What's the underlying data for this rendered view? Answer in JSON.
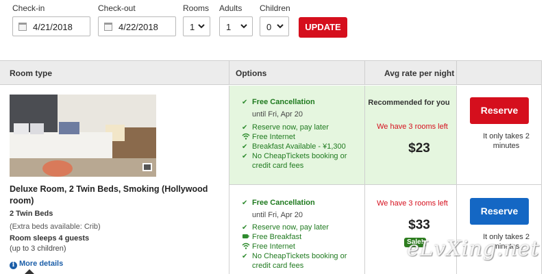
{
  "search": {
    "checkin_label": "Check-in",
    "checkin_value": "4/21/2018",
    "checkout_label": "Check-out",
    "checkout_value": "4/22/2018",
    "rooms_label": "Rooms",
    "rooms_value": "1",
    "adults_label": "Adults",
    "adults_value": "1",
    "children_label": "Children",
    "children_value": "0",
    "update_label": "UPDATE"
  },
  "table": {
    "col_room_type": "Room type",
    "col_options": "Options",
    "col_avg_rate": "Avg rate per night"
  },
  "room": {
    "photo_icon": "gallery-icon",
    "title": "Deluxe Room, 2 Twin Beds, Smoking (Hollywood room)",
    "beds": "2 Twin Beds",
    "extra_beds": "(Extra beds available: Crib)",
    "sleeps": "Room sleeps 4 guests",
    "children": "(up to 3 children)",
    "more_details": "More details"
  },
  "options": [
    {
      "free_cancellation": "Free Cancellation",
      "until": "until Fri, Apr 20",
      "features": [
        "Reserve now, pay later",
        "Free Internet",
        "Breakfast Available - ¥1,300",
        "No CheapTickets booking or",
        "credit card fees"
      ],
      "recommended": "Recommended for you",
      "rooms_left": "We have 3 rooms left",
      "price": "$23",
      "reserve_label": "Reserve",
      "takes": "It only takes 2 minutes"
    },
    {
      "free_cancellation": "Free Cancellation",
      "until": "until Fri, Apr 20",
      "features": [
        "Reserve now, pay later",
        "Free Breakfast",
        "Free Internet",
        "No CheapTickets booking or",
        "credit card fees"
      ],
      "rooms_left": "We have 3 rooms left",
      "price": "$33",
      "sale_badge": "Sale!",
      "reserve_label": "Reserve",
      "takes": "It only takes 2 minutes"
    }
  ],
  "watermark": "eLvXing.net",
  "colors": {
    "update_button": "#d50f1d",
    "reserve_primary": "#d50f1d",
    "reserve_secondary": "#1467c4",
    "recommended_bg": "#e5f6df",
    "feature_text": "#1f7a1f",
    "rooms_left_text": "#d50f1d",
    "sale_badge": "#2d7d1f",
    "link": "#1b5ea8"
  }
}
